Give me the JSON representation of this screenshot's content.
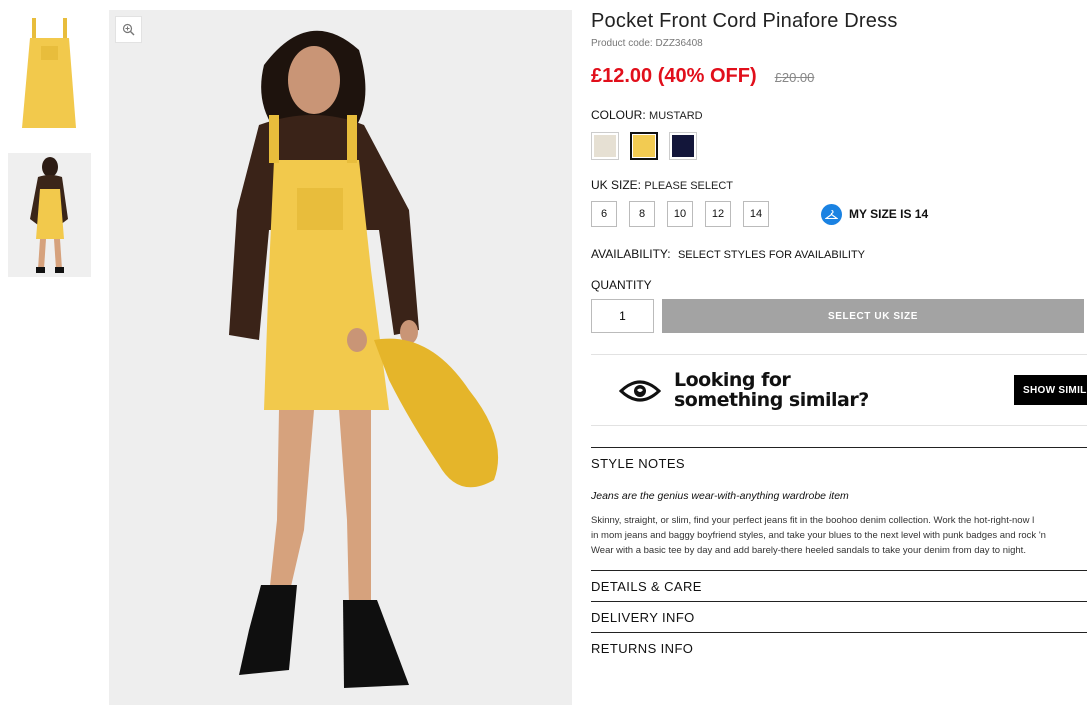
{
  "product": {
    "title": "Pocket Front Cord Pinafore Dress",
    "code": "Product code: DZZ36408",
    "price": "£12.00 (40% OFF)",
    "old_price": "£20.00"
  },
  "colour": {
    "label": "COLOUR:",
    "value": "MUSTARD",
    "swatches": [
      {
        "name": "cream",
        "color": "#e6e0d3"
      },
      {
        "name": "mustard",
        "color": "#f2cb52"
      },
      {
        "name": "navy",
        "color": "#13163a"
      }
    ]
  },
  "size": {
    "label": "UK SIZE:",
    "value": "PLEASE SELECT",
    "options": [
      "6",
      "8",
      "10",
      "12",
      "14"
    ],
    "helper": "MY SIZE IS 14"
  },
  "availability": {
    "label": "AVAILABILITY:",
    "value": "SELECT STYLES FOR AVAILABILITY"
  },
  "quantity": {
    "label": "QUANTITY",
    "value": "1"
  },
  "add_button": "SELECT UK SIZE",
  "similar": {
    "line1": "Looking for",
    "line2": "something similar?",
    "button": "SHOW SIMILAR"
  },
  "style_notes": {
    "heading": "STYLE NOTES",
    "lead": "Jeans are the genius wear-with-anything wardrobe item",
    "lines": [
      "Skinny, straight, or slim, find your perfect jeans fit in the boohoo denim collection. Work the hot-right-now l",
      "in mom jeans and baggy boyfriend styles, and take your blues to the next level with punk badges and rock 'n",
      "Wear with a basic tee by day and add barely-there heeled sandals to take your denim from day to night."
    ]
  },
  "accordion": [
    "DETAILS & CARE",
    "DELIVERY INFO",
    "RETURNS INFO"
  ],
  "colors": {
    "sale_red": "#e10f1b",
    "button_grey": "#a3a3a3",
    "helper_blue": "#1a82e2",
    "dress_yellow": "#f2c94c"
  }
}
